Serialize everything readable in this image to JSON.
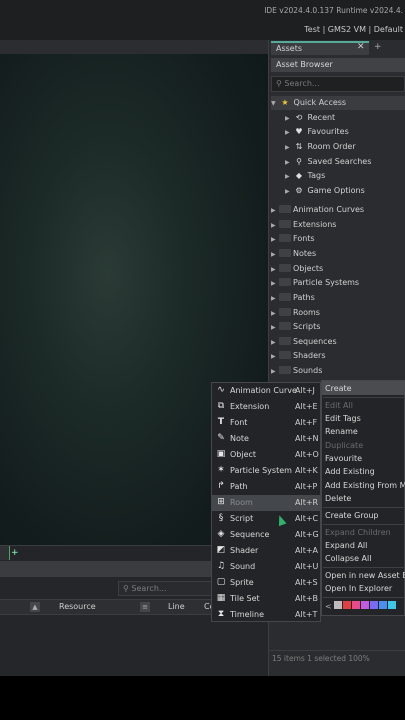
{
  "topbar": {
    "ide_version": "IDE v2024.4.0.137  Runtime v2024.4.",
    "target": "Test | GMS2 VM | Default"
  },
  "assets_panel": {
    "tab_label": "Assets",
    "browser_title": "Asset Browser",
    "search_placeholder": "Search...",
    "quick_access": {
      "label": "Quick Access",
      "items": [
        {
          "label": "Recent",
          "icon": "history-icon"
        },
        {
          "label": "Favourites",
          "icon": "heart-icon"
        },
        {
          "label": "Room Order",
          "icon": "room-order-icon"
        },
        {
          "label": "Saved Searches",
          "icon": "search-icon"
        },
        {
          "label": "Tags",
          "icon": "tag-icon"
        },
        {
          "label": "Game Options",
          "icon": "gear-icon"
        }
      ]
    },
    "folders": [
      "Animation Curves",
      "Extensions",
      "Fonts",
      "Notes",
      "Objects",
      "Particle Systems",
      "Paths",
      "Rooms",
      "Scripts",
      "Sequences",
      "Shaders",
      "Sounds"
    ],
    "status": "15 items   1 selected            100%"
  },
  "output_panel": {
    "search_placeholder": "Search...",
    "columns": {
      "resource": "Resource",
      "line": "Line",
      "co": "Co"
    }
  },
  "context_menu": {
    "create": "Create",
    "items": [
      {
        "label": "Edit All",
        "enabled": false
      },
      {
        "label": "Edit Tags",
        "enabled": true
      },
      {
        "label": "Rename",
        "enabled": true
      },
      {
        "label": "Duplicate",
        "enabled": false
      },
      {
        "label": "Favourite",
        "enabled": true
      },
      {
        "label": "Add Existing",
        "enabled": true
      },
      {
        "label": "Add Existing From My",
        "enabled": true
      },
      {
        "label": "Delete",
        "enabled": true
      }
    ],
    "group_items": [
      {
        "label": "Create Group",
        "enabled": true
      },
      {
        "label": "Expand Children",
        "enabled": false
      },
      {
        "label": "Expand All",
        "enabled": true
      },
      {
        "label": "Collapse All",
        "enabled": true
      }
    ],
    "explorer_items": [
      {
        "label": "Open in new Asset Br",
        "enabled": true
      },
      {
        "label": "Open In Explorer",
        "enabled": true
      }
    ],
    "swatches": [
      "#bdbdbd",
      "#e04040",
      "#e84a8a",
      "#c05ce0",
      "#7a6cf0",
      "#4a8ef0",
      "#3ec8e8"
    ]
  },
  "create_submenu": [
    {
      "label": "Animation Curve",
      "shortcut": "Alt+J",
      "icon": "curve-icon"
    },
    {
      "label": "Extension",
      "shortcut": "Alt+E",
      "icon": "extension-icon"
    },
    {
      "label": "Font",
      "shortcut": "Alt+F",
      "icon": "font-icon"
    },
    {
      "label": "Note",
      "shortcut": "Alt+N",
      "icon": "note-icon"
    },
    {
      "label": "Object",
      "shortcut": "Alt+O",
      "icon": "object-icon"
    },
    {
      "label": "Particle System",
      "shortcut": "Alt+K",
      "icon": "particle-icon"
    },
    {
      "label": "Path",
      "shortcut": "Alt+P",
      "icon": "path-icon"
    },
    {
      "label": "Room",
      "shortcut": "Alt+R",
      "icon": "room-icon"
    },
    {
      "label": "Script",
      "shortcut": "Alt+C",
      "icon": "script-icon"
    },
    {
      "label": "Sequence",
      "shortcut": "Alt+G",
      "icon": "sequence-icon"
    },
    {
      "label": "Shader",
      "shortcut": "Alt+A",
      "icon": "shader-icon"
    },
    {
      "label": "Sound",
      "shortcut": "Alt+U",
      "icon": "sound-icon"
    },
    {
      "label": "Sprite",
      "shortcut": "Alt+S",
      "icon": "sprite-icon"
    },
    {
      "label": "Tile Set",
      "shortcut": "Alt+B",
      "icon": "tileset-icon"
    },
    {
      "label": "Timeline",
      "shortcut": "Alt+T",
      "icon": "timeline-icon"
    }
  ]
}
